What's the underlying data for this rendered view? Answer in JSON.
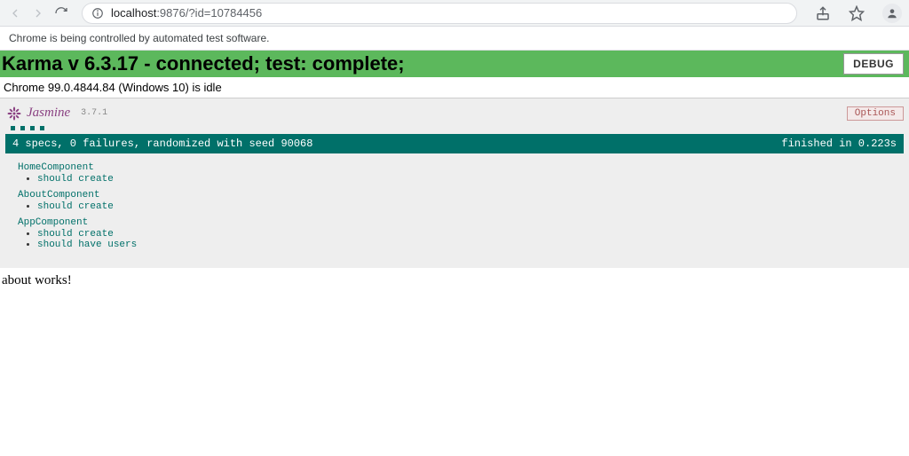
{
  "browser": {
    "url_host": "localhost",
    "url_rest": ":9876/?id=10784456",
    "automation_banner": "Chrome is being controlled by automated test software."
  },
  "karma": {
    "title": "Karma v 6.3.17 - connected; test: complete;",
    "debug_label": "DEBUG",
    "browser_status": "Chrome 99.0.4844.84 (Windows 10) is idle"
  },
  "jasmine": {
    "name": "Jasmine",
    "version": "3.7.1",
    "options_label": "Options",
    "result_summary": "4 specs, 0 failures, randomized with seed 90068",
    "finished_text": "finished in 0.223s",
    "spec_dot_count": 4,
    "suites": [
      {
        "name": "HomeComponent",
        "specs": [
          "should create"
        ]
      },
      {
        "name": "AboutComponent",
        "specs": [
          "should create"
        ]
      },
      {
        "name": "AppComponent",
        "specs": [
          "should create",
          "should have users"
        ]
      }
    ]
  },
  "app_output": "about works!"
}
